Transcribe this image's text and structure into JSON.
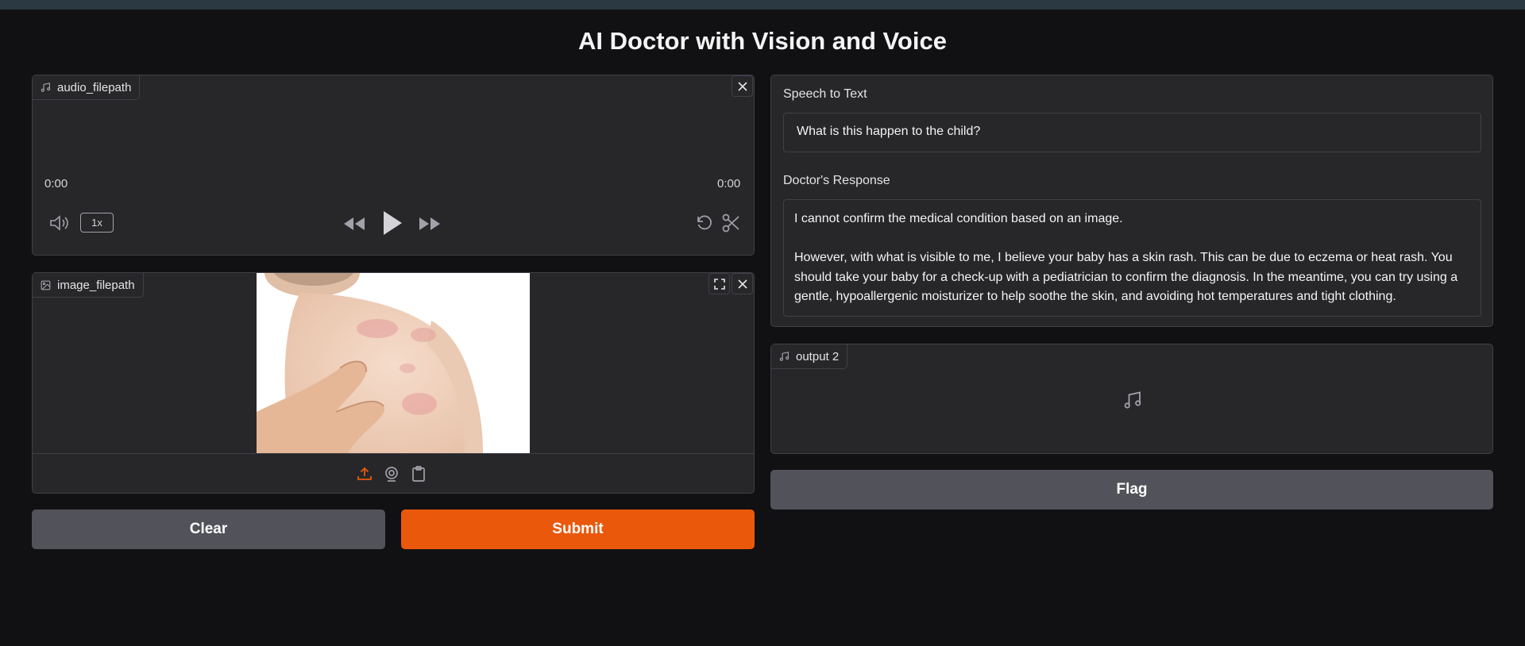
{
  "page": {
    "title": "AI Doctor with Vision and Voice"
  },
  "audio_input": {
    "label": "audio_filepath",
    "current_time": "0:00",
    "duration": "0:00",
    "playback_rate": "1x"
  },
  "image_input": {
    "label": "image_filepath",
    "image_description": "baby back with red skin rash"
  },
  "actions": {
    "clear_label": "Clear",
    "submit_label": "Submit",
    "flag_label": "Flag"
  },
  "speech_to_text": {
    "label": "Speech to Text",
    "value": "What is this happen to the child?"
  },
  "doctor_response": {
    "label": "Doctor's Response",
    "paragraph_1": "I cannot confirm the medical condition based on an image.",
    "paragraph_2": "However, with what is visible to me, I believe your baby has a skin rash. This can be due to eczema or heat rash. You should take your baby for a check-up with a pediatrician to confirm the diagnosis. In the meantime, you can try using a gentle, hypoallergenic moisturizer to help soothe the skin, and avoiding hot temperatures and tight clothing."
  },
  "audio_output": {
    "label": "output 2"
  },
  "colors": {
    "background": "#111113",
    "panel": "#27272a",
    "border": "#3f3f46",
    "accent": "#ea580c",
    "secondary_button": "#52525b"
  },
  "icons": [
    "music-note-icon",
    "close-icon",
    "volume-icon",
    "rewind-icon",
    "play-icon",
    "fast-forward-icon",
    "undo-icon",
    "scissors-icon",
    "image-icon",
    "fullscreen-icon",
    "upload-icon",
    "webcam-icon",
    "clipboard-icon"
  ]
}
